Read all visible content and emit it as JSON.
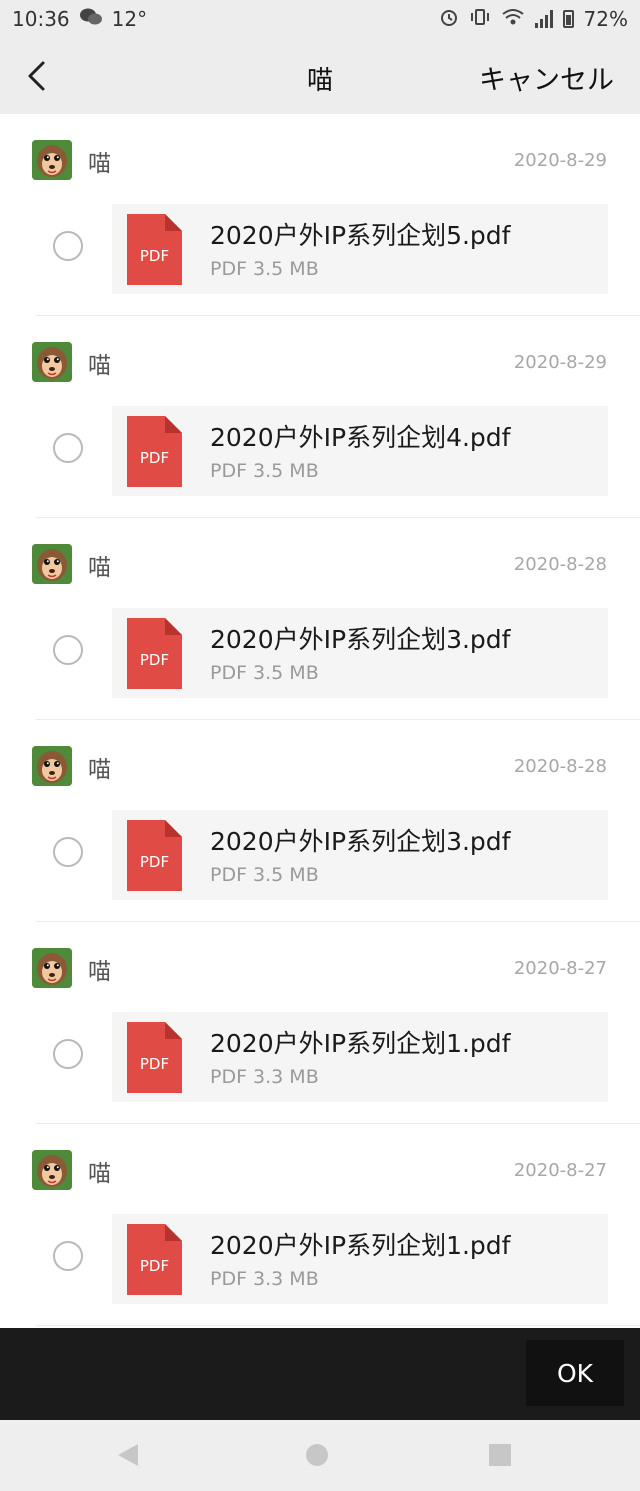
{
  "status": {
    "time": "10:36",
    "temp": "12°",
    "battery": "72%"
  },
  "header": {
    "title": "喵",
    "cancel_label": "キャンセル"
  },
  "items": [
    {
      "sender": "喵",
      "date": "2020-8-29",
      "file_name": "2020户外IP系列企划5.pdf",
      "file_meta": "PDF 3.5 MB",
      "icon_label": "PDF"
    },
    {
      "sender": "喵",
      "date": "2020-8-29",
      "file_name": "2020户外IP系列企划4.pdf",
      "file_meta": "PDF 3.5 MB",
      "icon_label": "PDF"
    },
    {
      "sender": "喵",
      "date": "2020-8-28",
      "file_name": "2020户外IP系列企划3.pdf",
      "file_meta": "PDF 3.5 MB",
      "icon_label": "PDF"
    },
    {
      "sender": "喵",
      "date": "2020-8-28",
      "file_name": "2020户外IP系列企划3.pdf",
      "file_meta": "PDF 3.5 MB",
      "icon_label": "PDF"
    },
    {
      "sender": "喵",
      "date": "2020-8-27",
      "file_name": "2020户外IP系列企划1.pdf",
      "file_meta": "PDF 3.3 MB",
      "icon_label": "PDF"
    },
    {
      "sender": "喵",
      "date": "2020-8-27",
      "file_name": "2020户外IP系列企划1.pdf",
      "file_meta": "PDF 3.3 MB",
      "icon_label": "PDF"
    }
  ],
  "footer": {
    "ok_label": "OK"
  },
  "colors": {
    "pdf_red": "#e04b45",
    "bar_bg": "#ededed",
    "action_bar": "#1b1b1b"
  },
  "icons": {
    "back": "chevron-left-icon",
    "file": "pdf-icon",
    "avatar": "dog-avatar-icon",
    "select": "radio-icon"
  }
}
